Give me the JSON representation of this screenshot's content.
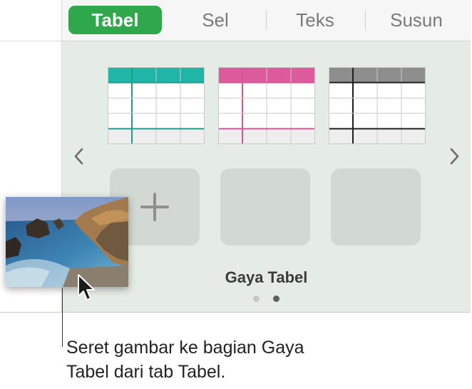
{
  "tabs": [
    {
      "label": "Tabel",
      "active": true
    },
    {
      "label": "Sel",
      "active": false
    },
    {
      "label": "Teks",
      "active": false
    },
    {
      "label": "Susun",
      "active": false
    }
  ],
  "table_styles": [
    {
      "accent": "#1fb5a7",
      "grid": "#1b9c8e"
    },
    {
      "accent": "#dd5a9c",
      "grid": "#d4569a"
    },
    {
      "accent": "#8e8e8e",
      "grid": "#1f1f1f"
    }
  ],
  "icons": {
    "prev": "chevron-left-icon",
    "next": "chevron-right-icon",
    "add": "plus-icon",
    "cursor": "pointer-cursor-icon"
  },
  "section_title": "Gaya Tabel",
  "pager": {
    "total": 2,
    "current": 2
  },
  "dragged_image": "coastal-landscape-photo",
  "caption_lines": [
    "Seret gambar ke bagian Gaya",
    "Tabel dari tab Tabel."
  ],
  "colors": {
    "active_tab": "#2ea84a",
    "panel": "#e5ece5",
    "slot": "#d2d9d2"
  }
}
